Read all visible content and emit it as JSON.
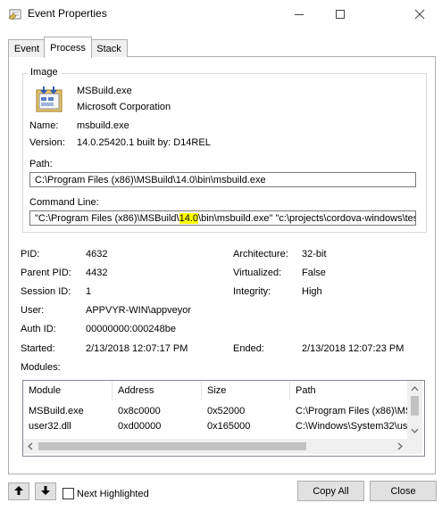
{
  "window": {
    "title": "Event Properties"
  },
  "tabs": [
    "Event",
    "Process",
    "Stack"
  ],
  "image": {
    "legend": "Image",
    "product": "MSBuild.exe",
    "company": "Microsoft Corporation",
    "name_label": "Name:",
    "name_value": "msbuild.exe",
    "version_label": "Version:",
    "version_value": "14.0.25420.1 built by: D14REL",
    "path_label": "Path:",
    "path_value": "C:\\Program Files (x86)\\MSBuild\\14.0\\bin\\msbuild.exe",
    "cmd_label": "Command Line:",
    "cmd_before": "\"C:\\Program Files (x86)\\MSBuild\\",
    "cmd_highlight": "14.0",
    "cmd_after": "\\bin\\msbuild.exe\" \"c:\\projects\\cordova-windows\\tes"
  },
  "details": {
    "pid_label": "PID:",
    "pid_value": "4632",
    "ppid_label": "Parent PID:",
    "ppid_value": "4432",
    "session_label": "Session ID:",
    "session_value": "1",
    "user_label": "User:",
    "user_value": "APPVYR-WIN\\appveyor",
    "auth_label": "Auth ID:",
    "auth_value": "00000000:000248be",
    "started_label": "Started:",
    "started_value": "2/13/2018 12:07:17 PM",
    "arch_label": "Architecture:",
    "arch_value": "32-bit",
    "virt_label": "Virtualized:",
    "virt_value": "False",
    "integrity_label": "Integrity:",
    "integrity_value": "High",
    "ended_label": "Ended:",
    "ended_value": "2/13/2018 12:07:23 PM",
    "modules_label": "Modules:"
  },
  "modules": {
    "columns": [
      "Module",
      "Address",
      "Size",
      "Path"
    ],
    "rows": [
      [
        "MSBuild.exe",
        "0x8c0000",
        "0x52000",
        "C:\\Program Files (x86)\\MS"
      ],
      [
        "user32.dll",
        "0xd00000",
        "0x165000",
        "C:\\Windows\\System32\\us"
      ]
    ]
  },
  "footer": {
    "next_highlighted": "Next Highlighted",
    "copy_all": "Copy All",
    "close": "Close"
  }
}
